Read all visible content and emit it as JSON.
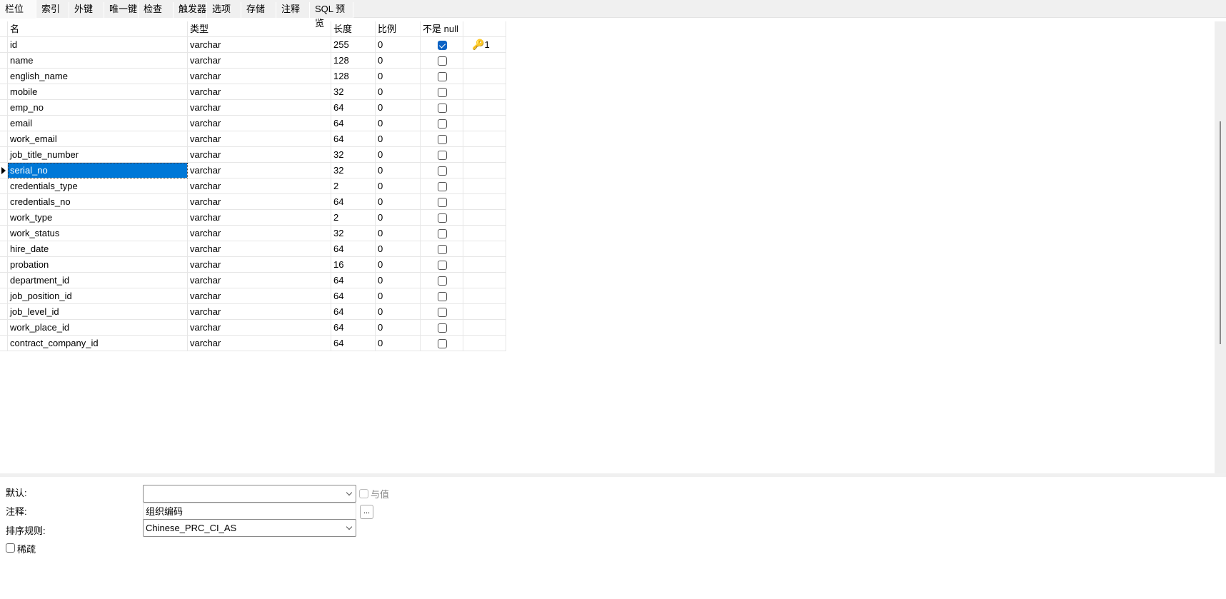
{
  "tabs": [
    "栏位",
    "索引",
    "外键",
    "唯一键",
    "检查",
    "触发器",
    "选项",
    "存储",
    "注释",
    "SQL 预览"
  ],
  "columns": [
    "名",
    "类型",
    "长度",
    "比例",
    "不是 null",
    ""
  ],
  "rows": [
    {
      "name": "id",
      "type": "varchar",
      "length": "255",
      "scale": "0",
      "not_null": true,
      "key": "1"
    },
    {
      "name": "name",
      "type": "varchar",
      "length": "128",
      "scale": "0",
      "not_null": false
    },
    {
      "name": "english_name",
      "type": "varchar",
      "length": "128",
      "scale": "0",
      "not_null": false
    },
    {
      "name": "mobile",
      "type": "varchar",
      "length": "32",
      "scale": "0",
      "not_null": false
    },
    {
      "name": "emp_no",
      "type": "varchar",
      "length": "64",
      "scale": "0",
      "not_null": false
    },
    {
      "name": "email",
      "type": "varchar",
      "length": "64",
      "scale": "0",
      "not_null": false
    },
    {
      "name": "work_email",
      "type": "varchar",
      "length": "64",
      "scale": "0",
      "not_null": false
    },
    {
      "name": "job_title_number",
      "type": "varchar",
      "length": "32",
      "scale": "0",
      "not_null": false
    },
    {
      "name": "serial_no",
      "type": "varchar",
      "length": "32",
      "scale": "0",
      "not_null": false,
      "selected": true
    },
    {
      "name": "credentials_type",
      "type": "varchar",
      "length": "2",
      "scale": "0",
      "not_null": false
    },
    {
      "name": "credentials_no",
      "type": "varchar",
      "length": "64",
      "scale": "0",
      "not_null": false
    },
    {
      "name": "work_type",
      "type": "varchar",
      "length": "2",
      "scale": "0",
      "not_null": false
    },
    {
      "name": "work_status",
      "type": "varchar",
      "length": "32",
      "scale": "0",
      "not_null": false
    },
    {
      "name": "hire_date",
      "type": "varchar",
      "length": "64",
      "scale": "0",
      "not_null": false
    },
    {
      "name": "probation",
      "type": "varchar",
      "length": "16",
      "scale": "0",
      "not_null": false
    },
    {
      "name": "department_id",
      "type": "varchar",
      "length": "64",
      "scale": "0",
      "not_null": false
    },
    {
      "name": "job_position_id",
      "type": "varchar",
      "length": "64",
      "scale": "0",
      "not_null": false
    },
    {
      "name": "job_level_id",
      "type": "varchar",
      "length": "64",
      "scale": "0",
      "not_null": false
    },
    {
      "name": "work_place_id",
      "type": "varchar",
      "length": "64",
      "scale": "0",
      "not_null": false
    },
    {
      "name": "contract_company_id",
      "type": "varchar",
      "length": "64",
      "scale": "0",
      "not_null": false
    }
  ],
  "props": {
    "default_label": "默认:",
    "default_value": "",
    "with_value_label": "与值",
    "comment_label": "注释:",
    "comment_value": "组织编码",
    "ellipsis": "...",
    "collation_label": "排序规则:",
    "collation_value": "Chinese_PRC_CI_AS",
    "sparse_label": "稀疏"
  }
}
